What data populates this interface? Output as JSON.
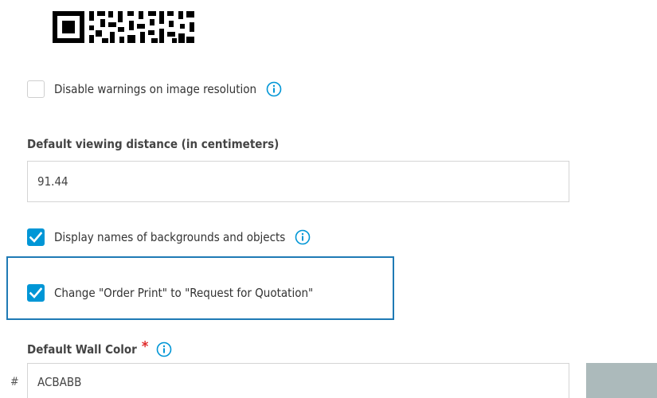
{
  "qr_code": {
    "icon": "qr-code-icon"
  },
  "options": {
    "disable_warnings": {
      "label": "Disable warnings on image resolution",
      "checked": false,
      "icon": "info-icon"
    },
    "display_names": {
      "label": "Display names of backgrounds and objects",
      "checked": true,
      "icon": "info-icon"
    },
    "change_order_print": {
      "label": "Change \"Order Print\" to \"Request for Quotation\"",
      "checked": true
    }
  },
  "viewing_distance": {
    "label": "Default viewing distance (in centimeters)",
    "value": "91.44"
  },
  "wall_color": {
    "label": "Default Wall Color",
    "required_mark": "*",
    "hash": "#",
    "value": "ACBABB",
    "swatch_color": "#ACBABB"
  },
  "colors": {
    "accent": "#0096d6",
    "focus_border": "#1f7ab5",
    "required": "#e02b2b"
  }
}
